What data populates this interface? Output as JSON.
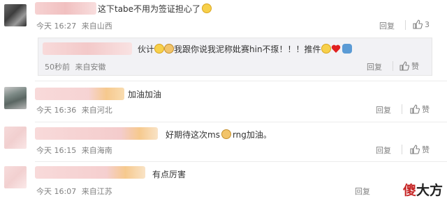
{
  "comments": [
    {
      "text": "这下tabe不用为签证担心了",
      "time": "今天 16:27",
      "source": "来自山西",
      "reply_label": "回复",
      "likes": "3"
    },
    {
      "text": "加油加油",
      "time": "今天 16:36",
      "source": "来自河北",
      "reply_label": "回复",
      "likes": ""
    },
    {
      "text_before": "好期待这次ms",
      "text_after": "rng加油。",
      "time": "今天 16:15",
      "source": "来自海南",
      "reply_label": "回复",
      "likes": ""
    },
    {
      "text": "有点厉害",
      "time": "今天 16:07",
      "source": "来自江苏",
      "reply_label": "回复",
      "likes": ""
    }
  ],
  "nested_reply": {
    "text_part1": "伙计",
    "text_part2": "我跟你说我泥称妣赛hin不揼！！！推件",
    "time": "50秒前",
    "source": "来自安徽",
    "reply_label": "回复",
    "like_label": "赞"
  },
  "like_label": "赞",
  "watermark": {
    "part1": "傻",
    "part2": "大方"
  },
  "colors": {
    "meta": "#808080",
    "reply_bg": "#f2f2f5",
    "watermark_red": "#c62828"
  }
}
